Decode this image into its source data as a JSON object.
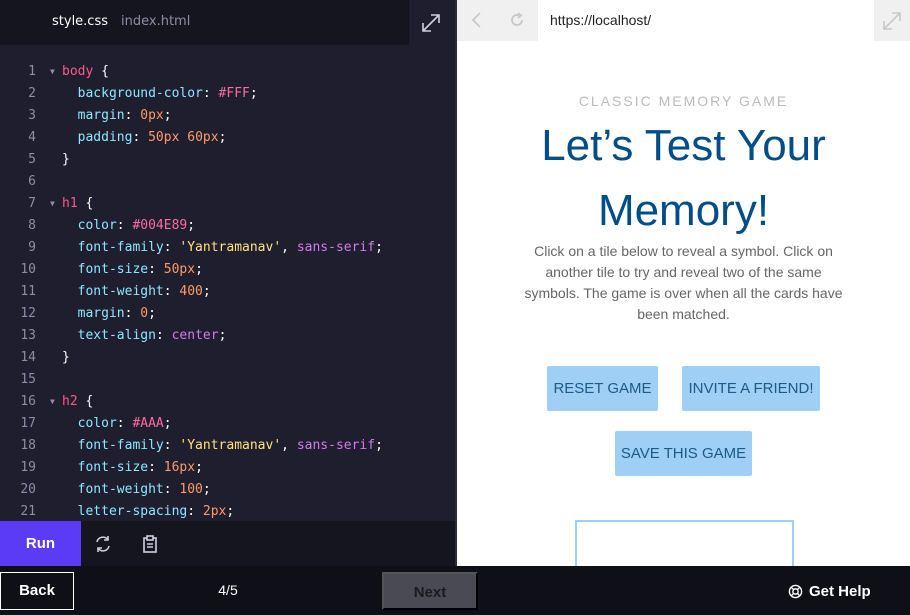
{
  "editor": {
    "tabs": [
      {
        "label": "style.css",
        "active": true
      },
      {
        "label": "index.html",
        "active": false
      }
    ],
    "lines": [
      {
        "n": "1",
        "fold": true,
        "tokens": [
          [
            "sel",
            "body"
          ],
          [
            "punc",
            " {"
          ]
        ]
      },
      {
        "n": "2",
        "fold": false,
        "tokens": [
          [
            "punc",
            "  "
          ],
          [
            "prop",
            "background-color"
          ],
          [
            "punc",
            ": "
          ],
          [
            "col",
            "#FFF"
          ],
          [
            "punc",
            ";"
          ]
        ]
      },
      {
        "n": "3",
        "fold": false,
        "tokens": [
          [
            "punc",
            "  "
          ],
          [
            "prop",
            "margin"
          ],
          [
            "punc",
            ": "
          ],
          [
            "num",
            "0px"
          ],
          [
            "punc",
            ";"
          ]
        ]
      },
      {
        "n": "4",
        "fold": false,
        "tokens": [
          [
            "punc",
            "  "
          ],
          [
            "prop",
            "padding"
          ],
          [
            "punc",
            ": "
          ],
          [
            "num",
            "50px 60px"
          ],
          [
            "punc",
            ";"
          ]
        ]
      },
      {
        "n": "5",
        "fold": false,
        "tokens": [
          [
            "punc",
            "}"
          ]
        ]
      },
      {
        "n": "6",
        "fold": false,
        "tokens": []
      },
      {
        "n": "7",
        "fold": true,
        "tokens": [
          [
            "sel",
            "h1"
          ],
          [
            "punc",
            " {"
          ]
        ]
      },
      {
        "n": "8",
        "fold": false,
        "tokens": [
          [
            "punc",
            "  "
          ],
          [
            "prop",
            "color"
          ],
          [
            "punc",
            ": "
          ],
          [
            "col",
            "#004E89"
          ],
          [
            "punc",
            ";"
          ]
        ]
      },
      {
        "n": "9",
        "fold": false,
        "tokens": [
          [
            "punc",
            "  "
          ],
          [
            "prop",
            "font-family"
          ],
          [
            "punc",
            ": "
          ],
          [
            "str",
            "'Yantramanav'"
          ],
          [
            "punc",
            ", "
          ],
          [
            "kw",
            "sans-serif"
          ],
          [
            "punc",
            ";"
          ]
        ]
      },
      {
        "n": "10",
        "fold": false,
        "tokens": [
          [
            "punc",
            "  "
          ],
          [
            "prop",
            "font-size"
          ],
          [
            "punc",
            ": "
          ],
          [
            "num",
            "50px"
          ],
          [
            "punc",
            ";"
          ]
        ]
      },
      {
        "n": "11",
        "fold": false,
        "tokens": [
          [
            "punc",
            "  "
          ],
          [
            "prop",
            "font-weight"
          ],
          [
            "punc",
            ": "
          ],
          [
            "num",
            "400"
          ],
          [
            "punc",
            ";"
          ]
        ]
      },
      {
        "n": "12",
        "fold": false,
        "tokens": [
          [
            "punc",
            "  "
          ],
          [
            "prop",
            "margin"
          ],
          [
            "punc",
            ": "
          ],
          [
            "num",
            "0"
          ],
          [
            "punc",
            ";"
          ]
        ]
      },
      {
        "n": "13",
        "fold": false,
        "tokens": [
          [
            "punc",
            "  "
          ],
          [
            "prop",
            "text-align"
          ],
          [
            "punc",
            ": "
          ],
          [
            "kw",
            "center"
          ],
          [
            "punc",
            ";"
          ]
        ]
      },
      {
        "n": "14",
        "fold": false,
        "tokens": [
          [
            "punc",
            "}"
          ]
        ]
      },
      {
        "n": "15",
        "fold": false,
        "tokens": []
      },
      {
        "n": "16",
        "fold": true,
        "tokens": [
          [
            "sel",
            "h2"
          ],
          [
            "punc",
            " {"
          ]
        ]
      },
      {
        "n": "17",
        "fold": false,
        "tokens": [
          [
            "punc",
            "  "
          ],
          [
            "prop",
            "color"
          ],
          [
            "punc",
            ": "
          ],
          [
            "col",
            "#AAA"
          ],
          [
            "punc",
            ";"
          ]
        ]
      },
      {
        "n": "18",
        "fold": false,
        "tokens": [
          [
            "punc",
            "  "
          ],
          [
            "prop",
            "font-family"
          ],
          [
            "punc",
            ": "
          ],
          [
            "str",
            "'Yantramanav'"
          ],
          [
            "punc",
            ", "
          ],
          [
            "kw",
            "sans-serif"
          ],
          [
            "punc",
            ";"
          ]
        ]
      },
      {
        "n": "19",
        "fold": false,
        "tokens": [
          [
            "punc",
            "  "
          ],
          [
            "prop",
            "font-size"
          ],
          [
            "punc",
            ": "
          ],
          [
            "num",
            "16px"
          ],
          [
            "punc",
            ";"
          ]
        ]
      },
      {
        "n": "20",
        "fold": false,
        "tokens": [
          [
            "punc",
            "  "
          ],
          [
            "prop",
            "font-weight"
          ],
          [
            "punc",
            ": "
          ],
          [
            "num",
            "100"
          ],
          [
            "punc",
            ";"
          ]
        ]
      },
      {
        "n": "21",
        "fold": false,
        "tokens": [
          [
            "punc",
            "  "
          ],
          [
            "prop",
            "letter-spacing"
          ],
          [
            "punc",
            ": "
          ],
          [
            "num",
            "2px"
          ],
          [
            "punc",
            ";"
          ]
        ]
      }
    ],
    "run_label": "Run"
  },
  "browser": {
    "url": "https://localhost/",
    "page": {
      "subtitle": "CLASSIC MEMORY GAME",
      "title": "Let’s Test Your Memory!",
      "description": "Click on a tile below to reveal a symbol. Click on another tile to try and reveal two of the same symbols. The game is over when all the cards have been matched.",
      "reset_label": "RESET GAME",
      "invite_label": "INVITE A FRIEND!",
      "save_label": "SAVE THIS GAME"
    }
  },
  "footer": {
    "back_label": "Back",
    "progress": "4/5",
    "next_label": "Next",
    "help_label": "Get Help"
  },
  "colors": {
    "run_button": "#5b3bf5",
    "title": "#004E89",
    "game_button": "#9fcff5"
  }
}
